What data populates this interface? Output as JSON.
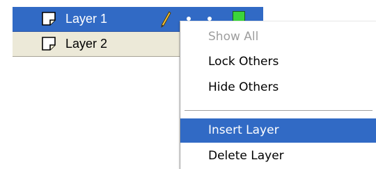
{
  "layers": [
    {
      "name": "Layer 1",
      "selected": true,
      "icon": "layer-page-icon",
      "status_icons": [
        "pencil-icon",
        "eye-dot-icon",
        "lock-dot-icon",
        "outline-color-swatch-icon"
      ],
      "outline_color": "#3bd43b"
    },
    {
      "name": "Layer 2",
      "selected": false,
      "icon": "layer-page-icon"
    }
  ],
  "context_menu": {
    "items": [
      {
        "label": "Show All",
        "enabled": false
      },
      {
        "label": "Lock Others",
        "enabled": true
      },
      {
        "label": "Hide Others",
        "enabled": true
      },
      {
        "label": "Insert Layer",
        "enabled": true,
        "highlighted": true
      },
      {
        "label": "Delete Layer",
        "enabled": true
      }
    ]
  },
  "colors": {
    "selection": "#316ac5",
    "panel_background": "#ece9d8",
    "menu_background": "#ffffff",
    "disabled_text": "#9e9e9e"
  }
}
